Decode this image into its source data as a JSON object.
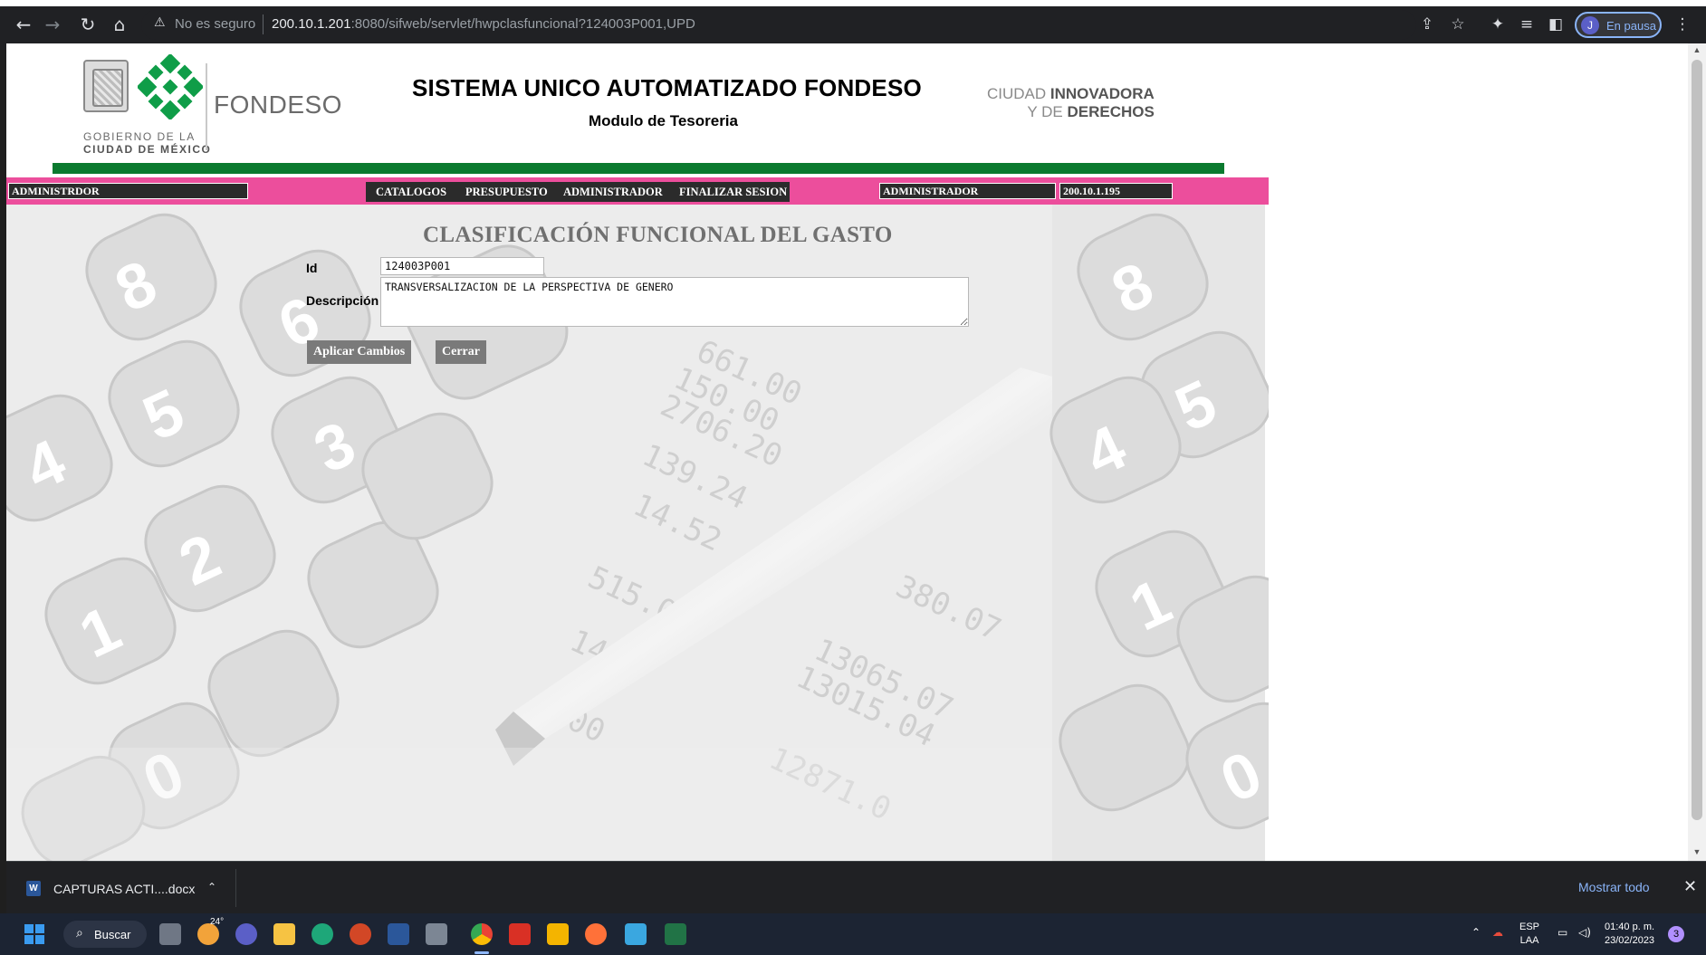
{
  "browser": {
    "security_label": "No es seguro",
    "url_host": "200.10.1.201",
    "url_rest": ":8080/sifweb/servlet/hwpclasfuncional?124003P001,UPD",
    "profile_initial": "J",
    "profile_status": "En pausa",
    "icons": [
      "back-arrow",
      "forward-arrow",
      "reload",
      "home",
      "warning",
      "share",
      "star",
      "extensions",
      "reading-list",
      "side-panel",
      "menu-dots"
    ]
  },
  "header": {
    "logo_text_line1": "GOBIERNO DE LA",
    "logo_text_line2": "CIUDAD DE MÉXICO",
    "org_name": "FONDESO",
    "system_title": "SISTEMA UNICO AUTOMATIZADO FONDESO",
    "module": "Modulo de Tesoreria",
    "slogan_line1_light": "CIUDAD ",
    "slogan_line1_bold": "INNOVADORA",
    "slogan_line2_light": "Y DE ",
    "slogan_line2_bold": "DERECHOS"
  },
  "navbar": {
    "user_role_left": "ADMINISTRDOR",
    "menu": [
      "CATALOGOS",
      "PRESUPUESTO",
      "ADMINISTRADOR",
      "FINALIZAR SESION"
    ],
    "user_role_right": "ADMINISTRADOR",
    "ip": "200.10.1.195"
  },
  "form": {
    "title": "CLASIFICACIÓN FUNCIONAL DEL GASTO",
    "id_label": "Id",
    "id_value": "124003P001",
    "desc_label": "Descripción",
    "desc_value": "TRANSVERSALIZACION DE LA PERSPECTIVA DE GENERO",
    "apply_label": "Aplicar Cambios",
    "close_label": "Cerrar"
  },
  "downloads": {
    "file_name": "CAPTURAS ACTI....docx",
    "show_all": "Mostrar todo"
  },
  "taskbar": {
    "search_label": "Buscar",
    "weather": "24°",
    "lang_line1": "ESP",
    "lang_line2": "LAA",
    "time": "01:40 p. m.",
    "date": "23/02/2023",
    "notif_count": "3"
  },
  "colors": {
    "green_bar": "#0b7a2f",
    "pink_bar": "#ec4e9c",
    "dark_box": "#2b2b2b",
    "button_gray": "#7a7a7a"
  }
}
